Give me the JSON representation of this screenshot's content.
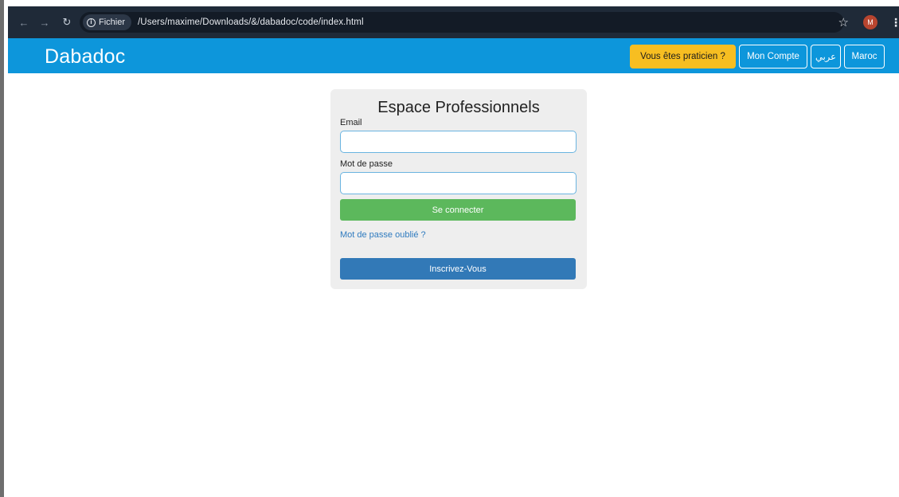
{
  "browser": {
    "back_icon": "arrow-left-icon",
    "forward_icon": "arrow-right-icon",
    "reload_icon": "reload-icon",
    "site_info_label": "Fichier",
    "url": "/Users/maxime/Downloads/&/dabadoc/code/index.html",
    "profile_initial": "M",
    "bookmark_icon": "star-icon",
    "menu_icon": "kebab-menu-icon"
  },
  "header": {
    "logo": "Dabadoc",
    "practitioner_button": "Vous êtes praticien ?",
    "account_button": "Mon Compte",
    "language_button": "عربي",
    "country_button": "Maroc"
  },
  "login": {
    "title": "Espace Professionnels",
    "email_label": "Email",
    "email_value": "",
    "password_label": "Mot de passe",
    "password_value": "",
    "submit_button": "Se connecter",
    "forgot_link": "Mot de passe oublié ?",
    "register_button": "Inscrivez-Vous"
  },
  "colors": {
    "header_bg": "#0d96db",
    "practitioner_bg": "#f7be21",
    "submit_bg": "#5cb85c",
    "register_bg": "#3279b7",
    "link": "#2f7bbf"
  }
}
